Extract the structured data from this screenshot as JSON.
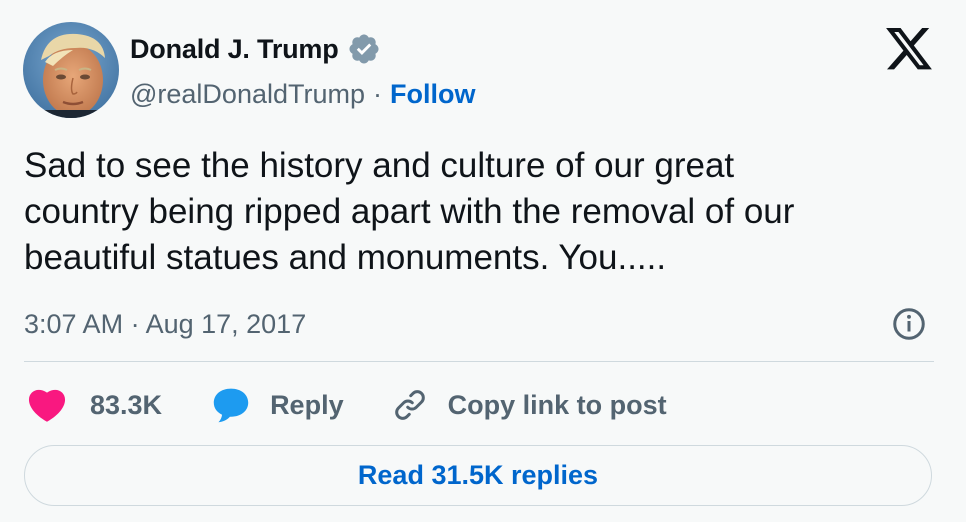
{
  "author": {
    "display_name": "Donald J. Trump",
    "handle": "@realDonaldTrump",
    "separator": "·",
    "follow_label": "Follow",
    "verified_badge_color": "#829aab",
    "avatar_icon": "profile-photo"
  },
  "platform_logo": "x-logo",
  "tweet": {
    "text": "Sad to see the history and culture of our great\ncountry being ripped apart with the removal of our\nbeautiful statues and monuments. You.....",
    "timestamp": "3:07 AM · Aug 17, 2017"
  },
  "actions": {
    "like_count": "83.3K",
    "reply_label": "Reply",
    "copy_link_label": "Copy link to post",
    "like_color": "#f91880",
    "reply_color": "#1d9bf0"
  },
  "read_replies_label": "Read 31.5K replies",
  "colors": {
    "accent": "#0066cc",
    "text": "#0f1419",
    "secondary": "#536471",
    "background": "#f7f9f9"
  }
}
